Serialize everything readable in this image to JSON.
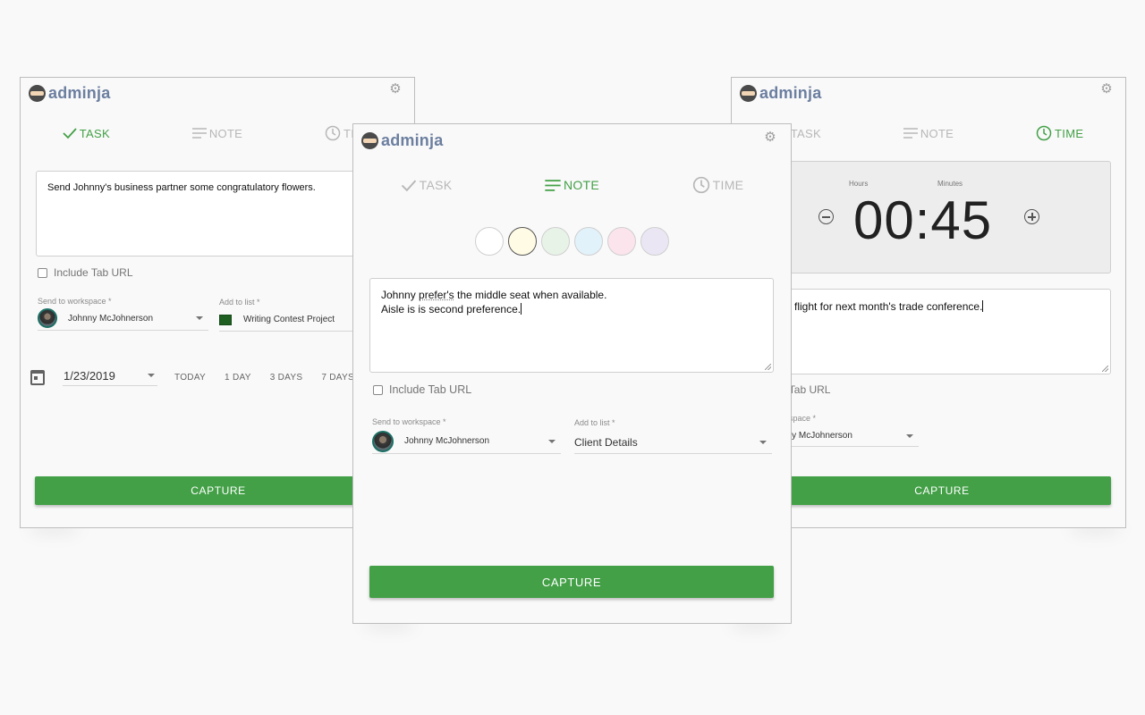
{
  "app": {
    "name": "adminja"
  },
  "tabs": {
    "task": "TASK",
    "note": "NOTE",
    "time": "TIME"
  },
  "common": {
    "include_tab_url": "Include Tab URL",
    "send_to_workspace_label": "Send to workspace *",
    "add_to_list_label": "Add to list *",
    "workspace_value": "Johnny McJohnerson",
    "capture_label": "CAPTURE",
    "accent_color": "#43a047"
  },
  "task_panel": {
    "active_tab": "TASK",
    "text": "Send Johnny's business partner some congratulatory flowers.",
    "list_value": "Writing Contest Project",
    "list_color": "#1e5e20",
    "date_value": "1/23/2019",
    "quick_dates": [
      "TODAY",
      "1 DAY",
      "3 DAYS",
      "7 DAYS"
    ]
  },
  "note_panel": {
    "active_tab": "NOTE",
    "text_line1_pre": "Johnny ",
    "text_line1_misspelled": "prefer's",
    "text_line1_post": " the middle seat when available.",
    "text_line2": "Aisle is is second preference.",
    "note_colors": [
      "#ffffff",
      "#fffbe5",
      "#e8f3e8",
      "#e1f2fb",
      "#fce4ec",
      "#ebe6f4"
    ],
    "selected_color_index": 1,
    "list_value": "Client Details"
  },
  "time_panel": {
    "active_tab": "TIME",
    "hours_label": "Hours",
    "minutes_label": "Minutes",
    "time_value": "00:45",
    "text_visible": "flight for next month's trade conference.",
    "include_tab_url_visible": "e Tab URL",
    "workspace_label_visible": "space *",
    "workspace_value_visible": "nny McJohnerson"
  }
}
